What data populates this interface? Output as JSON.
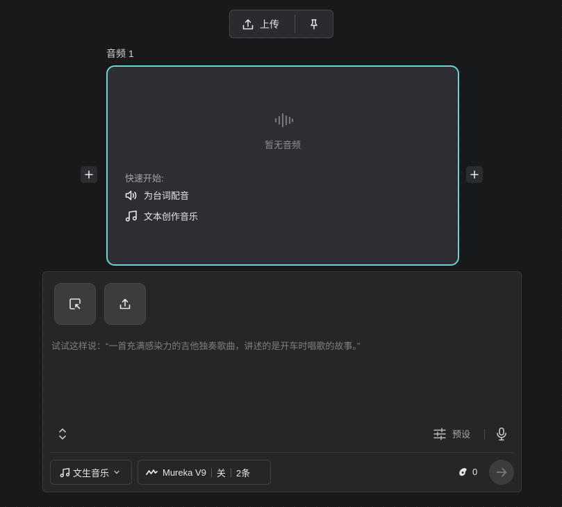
{
  "toolbar": {
    "upload_label": "上传",
    "upload_icon": "upload-icon",
    "pin_icon": "pin-icon"
  },
  "node": {
    "title": "音频 1",
    "empty_icon": "audio-wave-icon",
    "empty_text": "暂无音频",
    "quick_start_label": "快速开始:",
    "quick_items": [
      {
        "label": "为台词配音",
        "icon": "speaker-icon"
      },
      {
        "label": "文本创作音乐",
        "icon": "music-note-icon"
      }
    ],
    "accent_color": "#6dd3d6"
  },
  "composer": {
    "placeholder": "试试这样说：“一首充满感染力的吉他独奏歌曲，讲述的是开车时唱歌的故事。”",
    "preset_label": "预设",
    "mode_label": "文生音乐",
    "model_name": "Mureka V9",
    "model_option_1": "关",
    "model_option_2": "2条",
    "credits": "0"
  }
}
